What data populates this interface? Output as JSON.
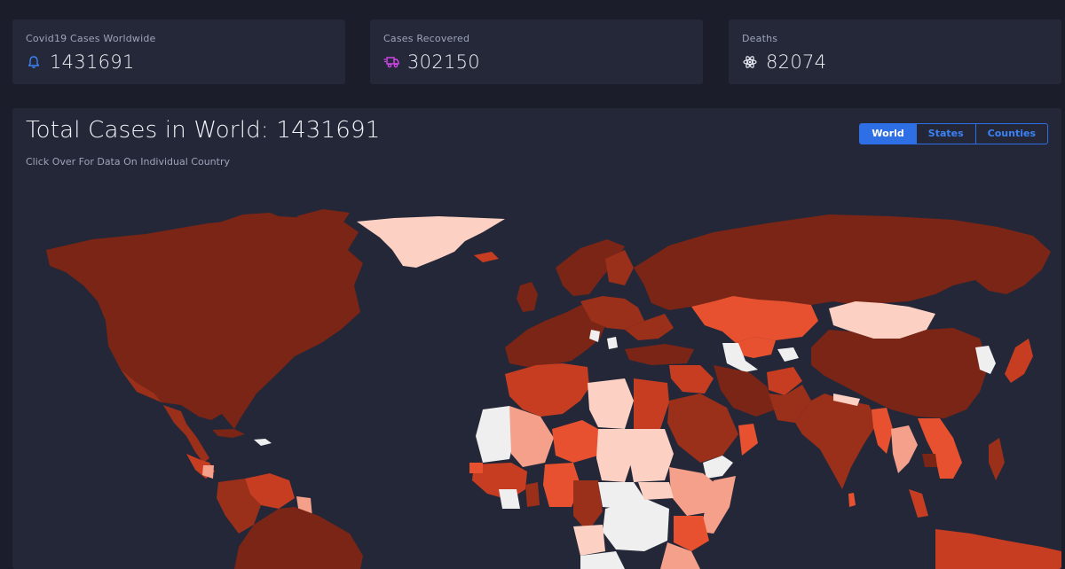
{
  "stats": [
    {
      "label": "Covid19 Cases Worldwide",
      "value": "1431691",
      "icon": "bell-icon",
      "color": "#3b82f6"
    },
    {
      "label": "Cases Recovered",
      "value": "302150",
      "icon": "delivery-truck-icon",
      "color": "#d946ef"
    },
    {
      "label": "Deaths",
      "value": "82074",
      "icon": "atom-icon",
      "color": "#e6e8f2"
    }
  ],
  "map_panel": {
    "title": "Total Cases in World: 1431691",
    "subtitle": "Click Over For Data On Individual Country",
    "tabs": [
      {
        "label": "World",
        "active": true
      },
      {
        "label": "States",
        "active": false
      },
      {
        "label": "Counties",
        "active": false
      }
    ]
  },
  "colors": {
    "background": "#1b1d2b",
    "card": "#252839",
    "accent": "#2f6fe6",
    "map_dark": "#7a2515",
    "map_mid": "#c63d22",
    "map_bright": "#ff5533",
    "map_light": "#f4a08a",
    "map_pale": "#fcd0c2",
    "map_none": "#efefef"
  }
}
